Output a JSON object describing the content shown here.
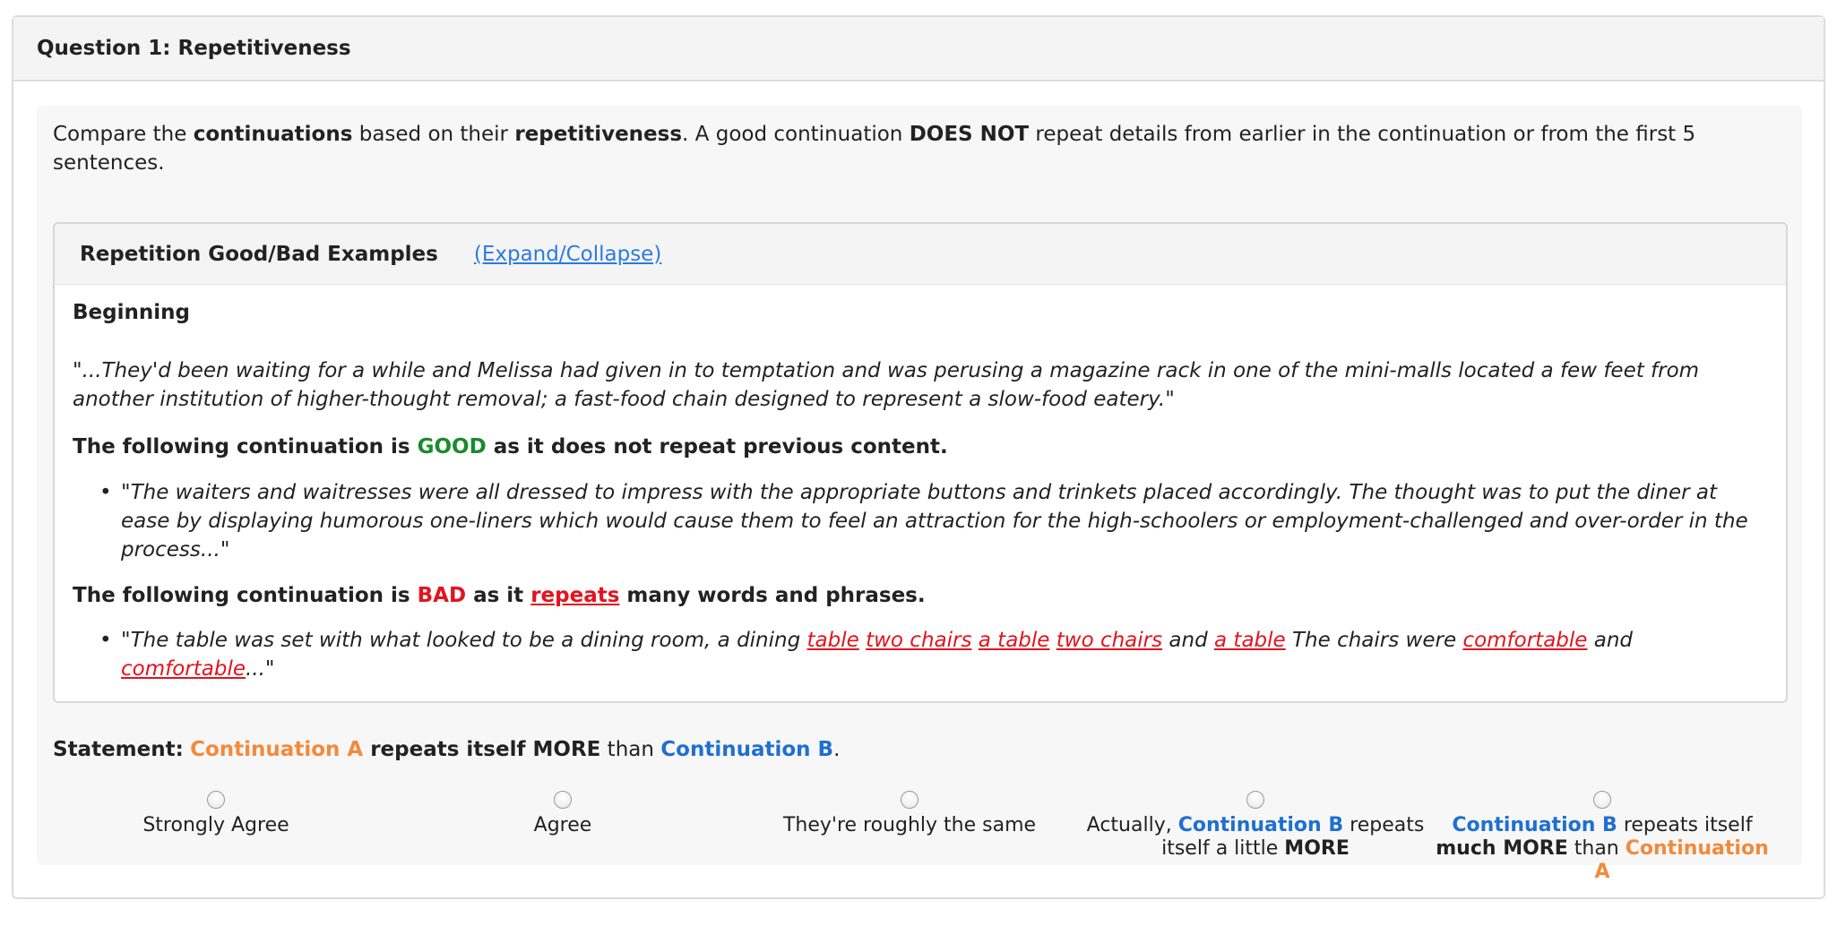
{
  "question": {
    "title": "Question 1: Repetitiveness"
  },
  "intro": {
    "p1": "Compare the ",
    "b1": "continuations",
    "p2": " based on their ",
    "b2": "repetitiveness",
    "p3": ". A good continuation ",
    "b3": "DOES NOT",
    "p4": " repeat details from earlier in the continuation or from the first 5 sentences."
  },
  "examples": {
    "title": "Repetition Good/Bad Examples",
    "expand_label": "(Expand/Collapse)",
    "beginning_label": "Beginning",
    "beginning_quote": "\"...They'd been waiting for a while and Melissa had given in to temptation and was perusing a magazine rack in one of the mini-malls located a few feet from another institution of higher-thought removal; a fast-food chain designed to represent a slow-food eatery.\"",
    "good": {
      "prefix": "The following continuation is ",
      "word": "GOOD",
      "suffix": " as it does not repeat previous content.",
      "quote": "\"The waiters and waitresses were all dressed to impress with the appropriate buttons and trinkets placed accordingly. The thought was to put the diner at ease by displaying humorous one-liners which would cause them to feel an attraction for the high-schoolers or employment-challenged and over-order in the process...\""
    },
    "bad": {
      "prefix": "The following continuation is ",
      "word": "BAD",
      "mid": " as it ",
      "rep_word": "repeats",
      "suffix": " many words and phrases.",
      "q1": "\"The table was set with what looked to be a dining room, a dining ",
      "r1": "table",
      "r2": "two chairs",
      "r3": "a table",
      "r4": "two chairs",
      "q2": " and ",
      "r5": "a table",
      "q3": " The chairs were ",
      "r6": "comfortable",
      "q4": " and ",
      "r7": "comfortable",
      "q5": "...\""
    }
  },
  "statement": {
    "label": "Statement:",
    "cont_a": "Continuation A",
    "mid": " repeats itself ",
    "more": "MORE",
    "than": " than ",
    "cont_b": "Continuation B",
    "end": "."
  },
  "options": {
    "o1": "Strongly Agree",
    "o2": "Agree",
    "o3": "They're roughly the same",
    "o4_pre": "Actually, ",
    "o4_b": "Continuation B",
    "o4_mid": " repeats itself a little ",
    "o4_more": "MORE",
    "o5_b": "Continuation B",
    "o5_mid": " repeats itself ",
    "o5_much": "much MORE",
    "o5_than": " than ",
    "o5_a": "Continuation A"
  },
  "colors": {
    "link_blue": "#2a7ae2",
    "good_green": "#1a8a2e",
    "bad_red": "#e3131e",
    "cont_a_orange": "#f28a3c",
    "cont_b_blue": "#1f6fd1"
  }
}
